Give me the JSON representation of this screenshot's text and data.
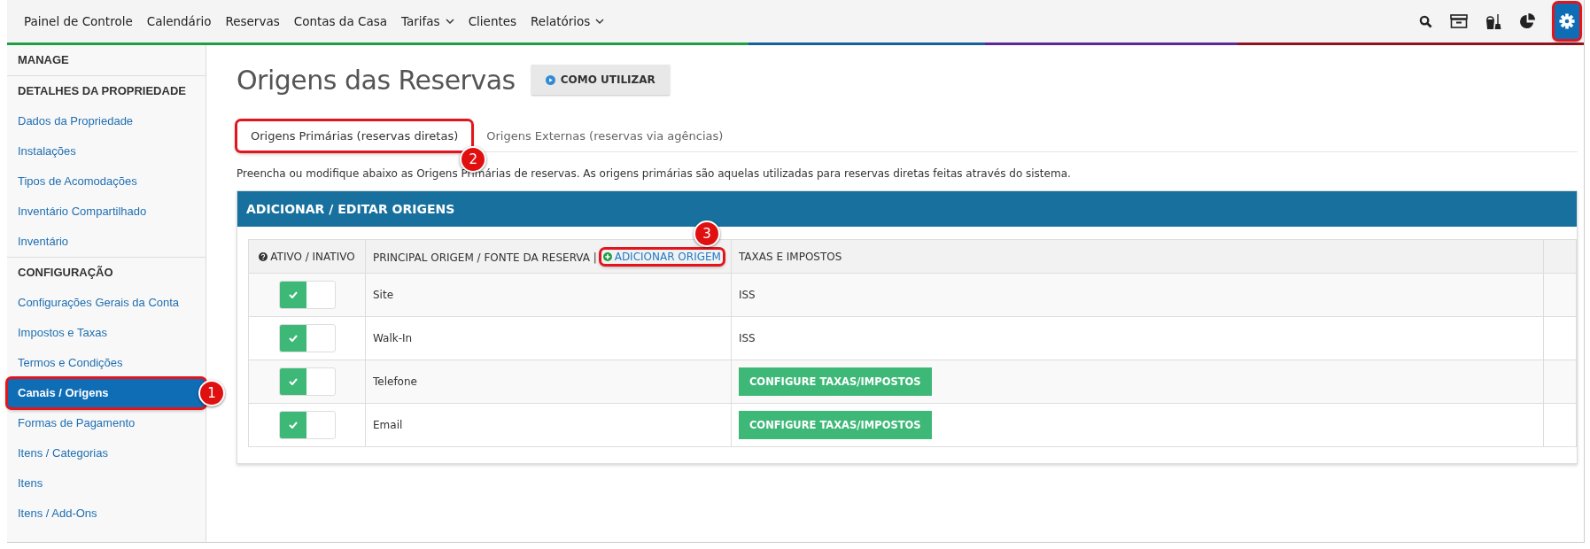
{
  "nav": {
    "items": [
      {
        "label": "Painel de Controle",
        "dropdown": false
      },
      {
        "label": "Calendário",
        "dropdown": false
      },
      {
        "label": "Reservas",
        "dropdown": false
      },
      {
        "label": "Contas da Casa",
        "dropdown": false
      },
      {
        "label": "Tarifas",
        "dropdown": true
      },
      {
        "label": "Clientes",
        "dropdown": false
      },
      {
        "label": "Relatórios",
        "dropdown": true
      }
    ],
    "settings_highlighted": true
  },
  "sidebar": {
    "title": "MANAGE",
    "sections": [
      {
        "heading": "DETALHES DA PROPRIEDADE",
        "items": [
          {
            "label": "Dados da Propriedade",
            "selected": false
          },
          {
            "label": "Instalações",
            "selected": false
          },
          {
            "label": "Tipos de Acomodações",
            "selected": false
          },
          {
            "label": "Inventário Compartilhado",
            "selected": false
          },
          {
            "label": "Inventário",
            "selected": false
          }
        ]
      },
      {
        "heading": "CONFIGURAÇÃO",
        "items": [
          {
            "label": "Configurações Gerais da Conta",
            "selected": false
          },
          {
            "label": "Impostos e Taxas",
            "selected": false
          },
          {
            "label": "Termos e Condições",
            "selected": false
          },
          {
            "label": "Canais / Origens",
            "selected": true,
            "callout": "1"
          },
          {
            "label": "Formas de Pagamento",
            "selected": false
          },
          {
            "label": "Itens / Categorias",
            "selected": false
          },
          {
            "label": "Itens",
            "selected": false
          },
          {
            "label": "Itens / Add-Ons",
            "selected": false
          }
        ]
      }
    ]
  },
  "main": {
    "title": "Origens das Reservas",
    "help_button": "COMO UTILIZAR",
    "tabs": [
      {
        "label": "Origens Primárias (reservas diretas)",
        "selected": true,
        "callout": "2"
      },
      {
        "label": "Origens Externas (reservas via agências)",
        "selected": false
      }
    ],
    "description": "Preencha ou modifique abaixo as Origens Primárias de reservas. As origens primárias são aquelas utilizadas para reservas diretas feitas através do sistema.",
    "panel": {
      "title": "ADICIONAR / EDITAR ORIGENS",
      "columns": [
        {
          "label": "ATIVO / INATIVO"
        },
        {
          "label": "PRINCIPAL ORIGEM / FONTE DA RESERVA",
          "separator": "|",
          "add_link": "ADICIONAR ORIGEM",
          "callout": "3"
        },
        {
          "label": "TAXAS E IMPOSTOS"
        }
      ],
      "rows": [
        {
          "active": true,
          "origin": "Site",
          "taxes": {
            "kind": "text",
            "label": "ISS"
          }
        },
        {
          "active": true,
          "origin": "Walk-In",
          "taxes": {
            "kind": "text",
            "label": "ISS"
          }
        },
        {
          "active": true,
          "origin": "Telefone",
          "taxes": {
            "kind": "button",
            "label": "CONFIGURE TAXAS/IMPOSTOS"
          }
        },
        {
          "active": true,
          "origin": "Email",
          "taxes": {
            "kind": "button",
            "label": "CONFIGURE TAXAS/IMPOSTOS"
          }
        }
      ]
    }
  }
}
